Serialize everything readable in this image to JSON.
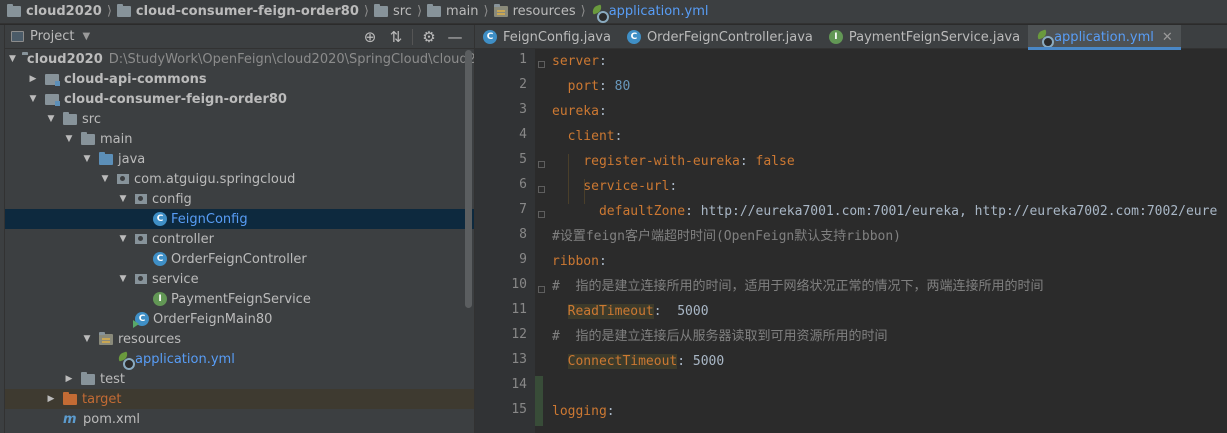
{
  "breadcrumb": {
    "items": [
      "cloud2020",
      "cloud-consumer-feign-order80",
      "src",
      "main",
      "resources",
      "application.yml"
    ]
  },
  "project_panel": {
    "title": "Project",
    "tree": [
      {
        "label": "cloud2020",
        "path": "D:\\StudyWork\\OpenFeign\\cloud2020\\SpringCloud\\cloud202"
      },
      {
        "label": "cloud-api-commons"
      },
      {
        "label": "cloud-consumer-feign-order80"
      },
      {
        "label": "src"
      },
      {
        "label": "main"
      },
      {
        "label": "java"
      },
      {
        "label": "com.atguigu.springcloud"
      },
      {
        "label": "config"
      },
      {
        "label": "FeignConfig"
      },
      {
        "label": "controller"
      },
      {
        "label": "OrderFeignController"
      },
      {
        "label": "service"
      },
      {
        "label": "PaymentFeignService"
      },
      {
        "label": "OrderFeignMain80"
      },
      {
        "label": "resources"
      },
      {
        "label": "application.yml"
      },
      {
        "label": "test"
      },
      {
        "label": "target"
      },
      {
        "label": "pom.xml"
      }
    ]
  },
  "tabs": [
    {
      "label": "FeignConfig.java",
      "badge": "C"
    },
    {
      "label": "OrderFeignController.java",
      "badge": "C"
    },
    {
      "label": "PaymentFeignService.java",
      "badge": "I"
    },
    {
      "label": "application.yml"
    }
  ],
  "editor": {
    "line_numbers": [
      "1",
      "2",
      "3",
      "4",
      "5",
      "6",
      "7",
      "8",
      "9",
      "10",
      "11",
      "12",
      "13",
      "14",
      "15"
    ],
    "lines": {
      "l1_key": "server",
      "l2_key": "port",
      "l2_val": "80",
      "l3_key": "eureka",
      "l4_key": "client",
      "l5_key": "register-with-eureka",
      "l5_val": "false",
      "l6_key": "service-url",
      "l7_key": "defaultZone",
      "l7_val": "http://eureka7001.com:7001/eureka, http://eureka7002.com:7002/eure",
      "l8_comment": "#设置feign客户端超时时间(OpenFeign默认支持ribbon)",
      "l9_key": "ribbon",
      "l10_comment": "#  指的是建立连接所用的时间，适用于网络状况正常的情况下，两端连接所用的时间",
      "l11_key": "ReadTimeout",
      "l11_val": "5000",
      "l12_comment": "#  指的是建立连接后从服务器读取到可用资源所用的时间",
      "l13_key": "ConnectTimeout",
      "l13_val": "5000",
      "l15_key": "logging"
    }
  }
}
